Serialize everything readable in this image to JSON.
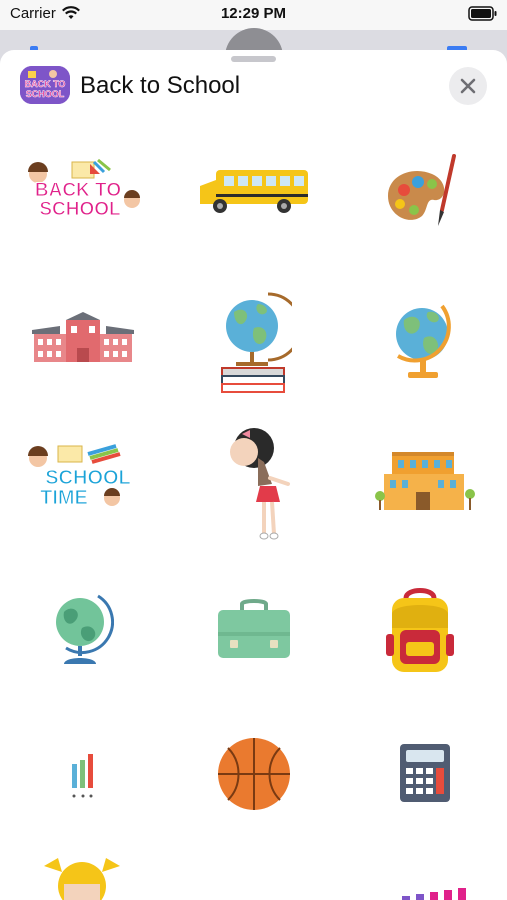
{
  "status_bar": {
    "carrier": "Carrier",
    "time": "12:29 PM"
  },
  "header": {
    "title": "Back to School",
    "icon_text_line1": "BACK TO",
    "icon_text_line2": "SCHOOL"
  },
  "stickers": {
    "back_to_school_line1": "BACK TO",
    "back_to_school_line2": "SCHOOL",
    "school_time_line1": "SCHOOL",
    "school_time_line2": "TIME"
  },
  "icons": [
    "wifi-icon",
    "battery-icon",
    "close-icon"
  ],
  "colors": {
    "accent": "#3b7cf3",
    "sheet_bg": "#ffffff",
    "title_pink": "#e0218a",
    "title_blue": "#1ba3d8"
  }
}
